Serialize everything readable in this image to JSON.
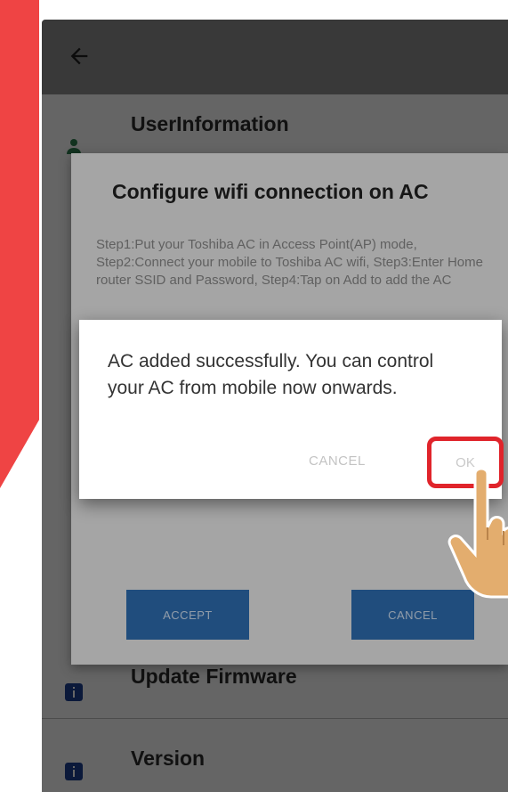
{
  "user_information_label": "UserInformation",
  "update_firmware_label": "Update Firmware",
  "version_label": "Version",
  "config_dialog": {
    "title": "Configure wifi connection on AC",
    "body": "Step1:Put your Toshiba AC in Access Point(AP) mode, Step2:Connect your mobile to Toshiba AC wifi, Step3:Enter Home router SSID and Password, Step4:Tap on Add to add the AC",
    "accept_label": "ACCEPT",
    "cancel_label": "CANCEL"
  },
  "alert_dialog": {
    "message": "AC added successfully. You can control your AC from mobile now onwards.",
    "cancel_label": "CANCEL",
    "ok_label": "OK"
  },
  "colors": {
    "banner_red": "#ef4444",
    "highlight_red": "#e0242b",
    "button_blue": "#2f6fb3"
  },
  "icons": [
    "back-arrow-icon",
    "person-icon",
    "info-icon",
    "pointing-hand-icon"
  ]
}
